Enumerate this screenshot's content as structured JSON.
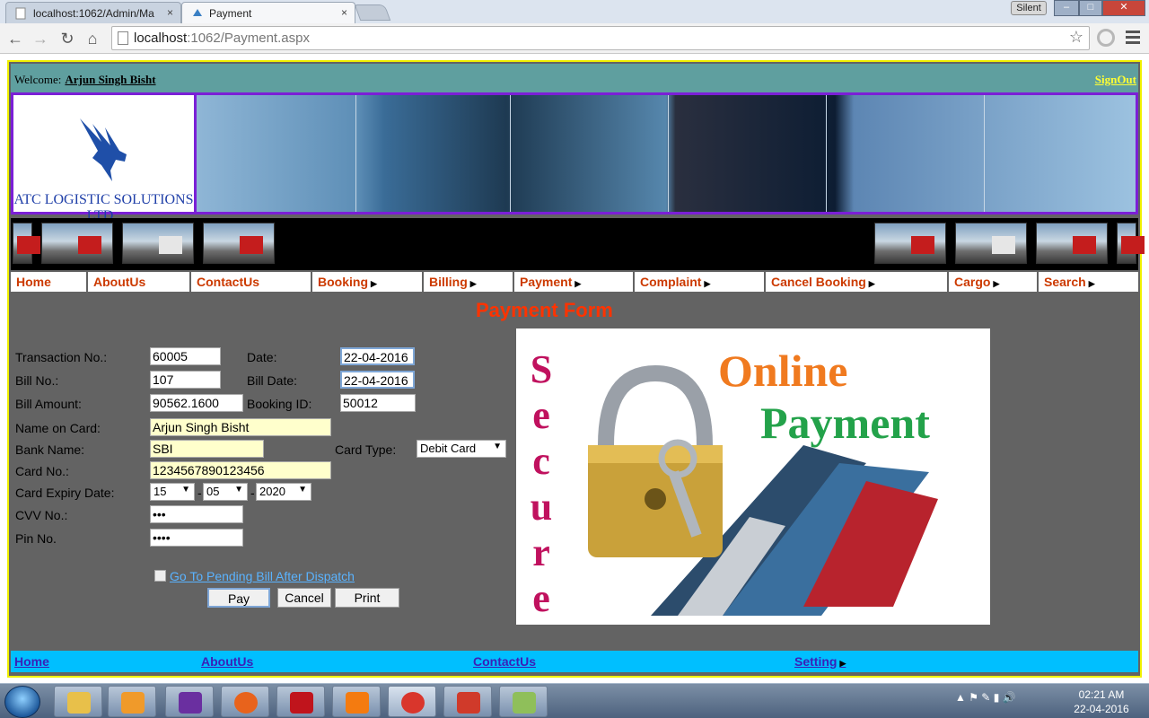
{
  "browser": {
    "tabs": [
      {
        "title": "localhost:1062/Admin/Ma"
      },
      {
        "title": "Payment"
      }
    ],
    "url_host": "localhost",
    "url_rest": ":1062/Payment.aspx",
    "silent_label": "Silent",
    "close_glyph": "×"
  },
  "header": {
    "welcome_label": "Welcome:",
    "user_name": "Arjun Singh Bisht",
    "signout_label": "SignOut"
  },
  "logo": {
    "company": "ATC LOGISTIC SOLUTIONS LTD.,",
    "color": "#1f3fa8"
  },
  "menu": {
    "items": [
      {
        "label": "Home",
        "submenu": false
      },
      {
        "label": "AboutUs",
        "submenu": false
      },
      {
        "label": "ContactUs",
        "submenu": false
      },
      {
        "label": "Booking",
        "submenu": true
      },
      {
        "label": "Billing",
        "submenu": true
      },
      {
        "label": "Payment",
        "submenu": true
      },
      {
        "label": "Complaint",
        "submenu": true
      },
      {
        "label": "Cancel Booking",
        "submenu": true
      },
      {
        "label": "Cargo",
        "submenu": true
      },
      {
        "label": "Search",
        "submenu": true
      }
    ],
    "arrow": "▶"
  },
  "form": {
    "title": "Payment Form",
    "labels": {
      "transaction_no": "Transaction No.:",
      "date": "Date:",
      "bill_no": "Bill No.:",
      "bill_date": "Bill Date:",
      "bill_amount": "Bill Amount:",
      "booking_id": "Booking ID:",
      "name_on_card": "Name on Card:",
      "bank_name": "Bank Name:",
      "card_type": "Card Type:",
      "card_no": "Card No.:",
      "card_expiry": "Card Expiry Date:",
      "cvv": "CVV No.:",
      "pin": "Pin No."
    },
    "values": {
      "transaction_no": "60005",
      "date": "22-04-2016",
      "bill_no": "107",
      "bill_date": "22-04-2016",
      "bill_amount": "90562.1600",
      "booking_id": "50012",
      "name_on_card": "Arjun Singh Bisht",
      "bank_name": "SBI",
      "card_type": "Debit Card",
      "card_no": "1234567890123456",
      "expiry_day": "15",
      "expiry_month": "05",
      "expiry_year": "2020",
      "cvv_masked": "•••",
      "pin_masked": "••••"
    },
    "expiry_sep": "-",
    "pending_link": "Go To Pending Bill After Dispatch",
    "buttons": {
      "pay": "Pay",
      "cancel": "Cancel",
      "print": "Print"
    },
    "dropdown_arrow": "▼"
  },
  "promo_image": {
    "secure_letters": [
      "S",
      "e",
      "c",
      "u",
      "r",
      "e"
    ],
    "online": "Online",
    "payment": "Payment"
  },
  "footer": {
    "links": [
      {
        "label": "Home"
      },
      {
        "label": "AboutUs"
      },
      {
        "label": "ContactUs"
      },
      {
        "label": "Setting"
      }
    ],
    "arrow": "▶"
  },
  "taskbar": {
    "time": "02:21 AM",
    "date": "22-04-2016"
  },
  "colors": {
    "page_bg": "#636363",
    "frame_border": "#f0f000",
    "welcome_bar": "#5f9f9f",
    "menu_text": "#cc3a00",
    "title": "#ff3300",
    "footer": "#00bfff",
    "link": "#5ab3ff"
  }
}
